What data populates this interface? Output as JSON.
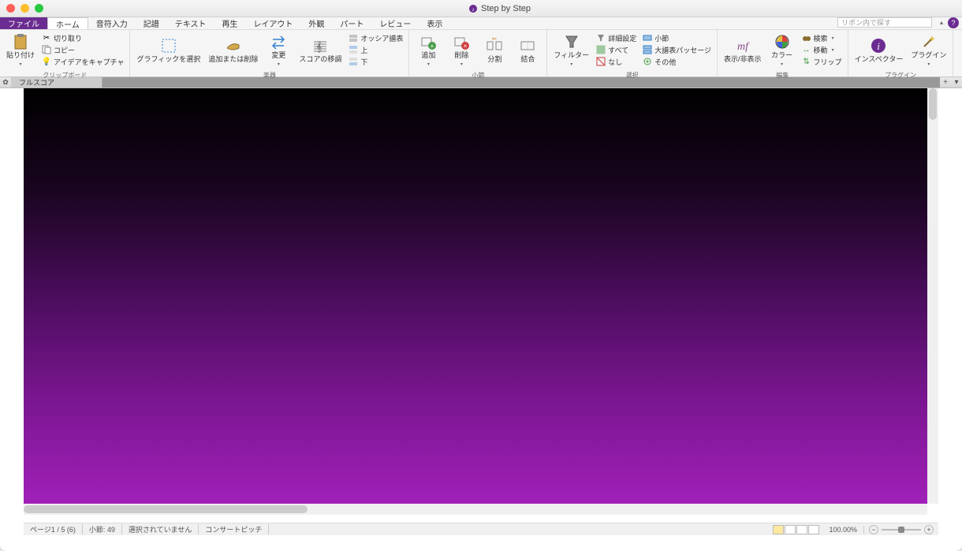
{
  "window": {
    "title": "Step by Step"
  },
  "menu": {
    "file": "ファイル",
    "tabs": [
      "ホーム",
      "音符入力",
      "記譜",
      "テキスト",
      "再生",
      "レイアウト",
      "外観",
      "パート",
      "レビュー",
      "表示"
    ],
    "search_placeholder": "リボン内で探す"
  },
  "ribbon": {
    "clipboard": {
      "label": "クリップボード",
      "paste": "貼り付け",
      "cut": "切り取り",
      "copy": "コピー",
      "capture": "アイデアをキャプチャ"
    },
    "instruments": {
      "label": "楽器",
      "select_graphic": "グラフィックを選択",
      "add_remove": "追加または削除",
      "change": "変更",
      "transpose": "スコアの移調",
      "ossia": "オッシア譜表",
      "above": "上",
      "below": "下"
    },
    "bars": {
      "label": "小節",
      "add": "追加",
      "delete": "削除",
      "split": "分割",
      "join": "結合"
    },
    "select": {
      "label": "選択",
      "filters": "フィルター",
      "advanced": "詳細設定",
      "all": "すべて",
      "none": "なし",
      "bars_sel": "小節",
      "system_passage": "大譜表パッセージ",
      "other": "その他"
    },
    "edit": {
      "label": "編集",
      "hide_show": "表示/非表示",
      "color": "カラー",
      "find": "検索",
      "move": "移動",
      "flip": "フリップ"
    },
    "plugin": {
      "label": "プラグイン",
      "inspector": "インスペクター",
      "plugins": "プラグイン"
    }
  },
  "doc_tab": "フルスコア",
  "status": {
    "page": "ページ1 / 5 (6)",
    "bars": "小節: 49",
    "selection": "選択されていません",
    "pitch": "コンサートピッチ",
    "zoom": "100.00%"
  }
}
